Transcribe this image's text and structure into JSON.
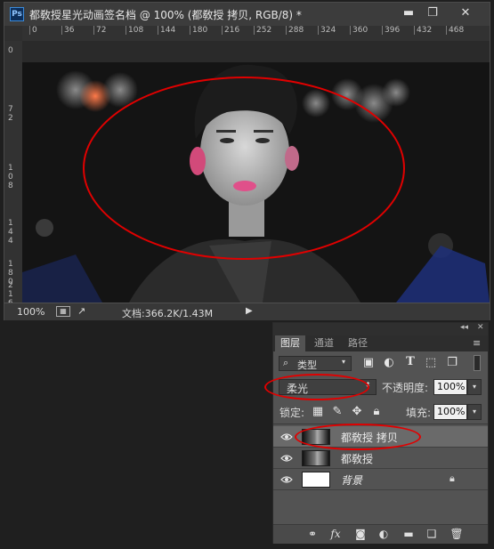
{
  "document": {
    "app_icon": "Ps",
    "title": "都敎授星光动画签名档 @ 100% (都敎授 拷贝, RGB/8) *",
    "window_controls": [
      "minimize-icon",
      "maximize-icon",
      "close-icon"
    ]
  },
  "rulers": {
    "horizontal": [
      "0",
      "36",
      "72",
      "108",
      "144",
      "180",
      "216",
      "252",
      "288",
      "324",
      "360",
      "396",
      "432",
      "468"
    ],
    "vertical": [
      "0",
      "7\n2",
      "1\n0\n8",
      "1\n4\n4",
      "1\n8\n0",
      "2\n1\n6"
    ]
  },
  "status": {
    "zoom": "100%",
    "doc_size": "文档:366.2K/1.43M"
  },
  "layers_panel": {
    "tabs": [
      "图层",
      "通道",
      "路径"
    ],
    "active_tab": "图层",
    "filter_label": "类型",
    "blend_mode": "柔光",
    "opacity_label": "不透明度:",
    "opacity_value": "100%",
    "lock_label": "锁定:",
    "fill_label": "填充:",
    "fill_value": "100%",
    "layers": [
      {
        "name": "都敎授 拷贝",
        "selected": true,
        "visible": true,
        "thumb": "photo"
      },
      {
        "name": "都敎授",
        "selected": false,
        "visible": true,
        "thumb": "photo"
      },
      {
        "name": "背景",
        "selected": false,
        "visible": true,
        "thumb": "white",
        "locked": true
      }
    ],
    "footer_icons": [
      "link-icon",
      "fx-icon",
      "mask-icon",
      "adjustment-icon",
      "folder-icon",
      "new-layer-icon",
      "trash-icon"
    ]
  },
  "annotation_color": "#e10000"
}
